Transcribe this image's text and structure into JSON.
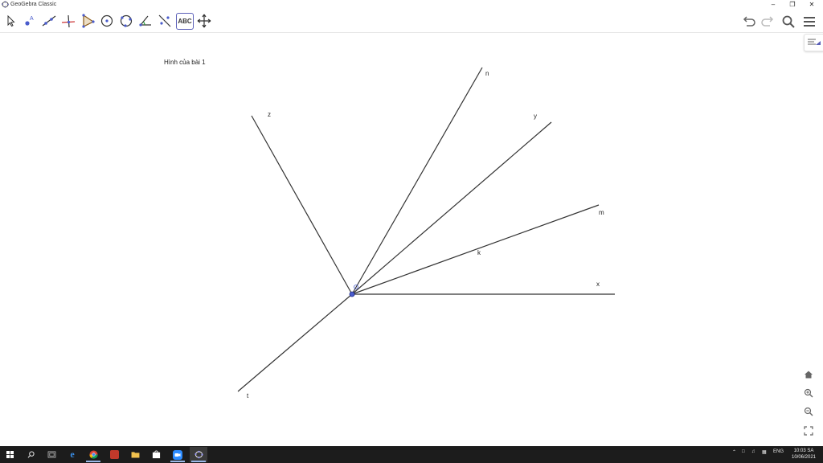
{
  "window": {
    "title": "GeoGebra Classic"
  },
  "toolbar": {
    "tools": [
      {
        "name": "move-tool-icon"
      },
      {
        "name": "point-tool-icon"
      },
      {
        "name": "line-tool-icon"
      },
      {
        "name": "perpendicular-tool-icon"
      },
      {
        "name": "polygon-tool-icon"
      },
      {
        "name": "circle-tool-icon"
      },
      {
        "name": "circle-three-points-tool-icon"
      },
      {
        "name": "angle-tool-icon"
      },
      {
        "name": "reflect-tool-icon"
      },
      {
        "name": "text-tool",
        "label": "ABC"
      },
      {
        "name": "move-view-tool-icon"
      }
    ]
  },
  "canvas": {
    "caption": "Hình của bài 1",
    "labels": {
      "n": "n",
      "y": "y",
      "z": "z",
      "m": "m",
      "k": "k",
      "x": "x",
      "t": "t"
    },
    "colors": {
      "line": "#333333",
      "point": "#4a5ccc"
    }
  },
  "taskbar": {
    "tray_lang": "ENG",
    "time": "10:03 SA",
    "date": "10/06/2021"
  }
}
